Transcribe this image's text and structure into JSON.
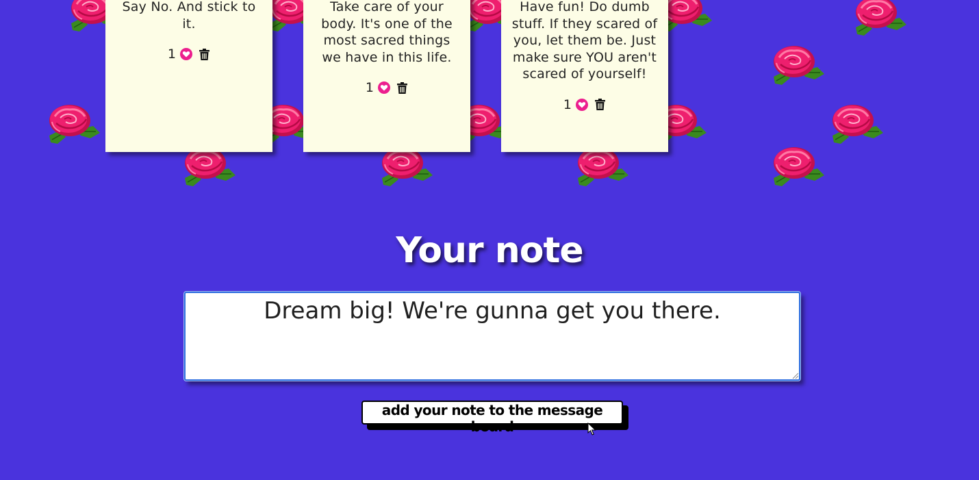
{
  "notes": [
    {
      "text": "Say No. And stick to it.",
      "likes": "1"
    },
    {
      "text": "Take care of your body. It's one of the most sacred things we have in this life.",
      "likes": "1"
    },
    {
      "text": "Have fun! Do dumb stuff. If they scared of you, let them be. Just make sure YOU aren't scared of yourself!",
      "likes": "1"
    }
  ],
  "compose": {
    "heading": "Your note",
    "value": "Dream big! We're gunna get you there.",
    "submit_label": "add your note to the message board"
  },
  "colors": {
    "background": "#4a33dd",
    "note_bg": "#fdfde6",
    "heart": "#ec1f8e",
    "rose": "#e8186a",
    "leaf": "#3a8a1e"
  },
  "icons": {
    "like": "heart-icon",
    "delete": "trash-icon",
    "decoration": "rose-icon"
  }
}
